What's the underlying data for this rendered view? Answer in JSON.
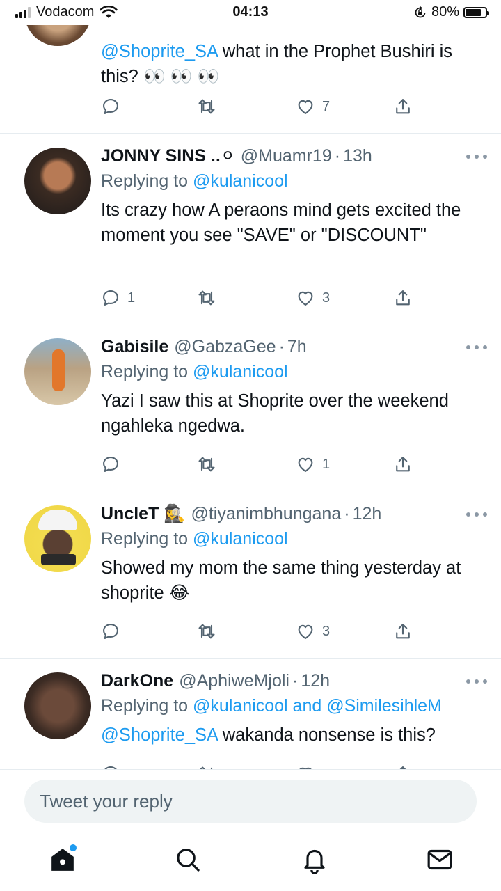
{
  "status": {
    "carrier": "Vodacom",
    "time": "04:13",
    "battery": "80%"
  },
  "tweets": [
    {
      "text_parts": [
        {
          "mention": "@Shoprite_SA"
        },
        {
          "text": " what in the Prophet Bushiri is this? 👀 👀 👀"
        }
      ],
      "reply_count": "",
      "like_count": "7"
    },
    {
      "name": "JONNY SINS ..⚪",
      "handle": "@Muamr19",
      "time": "13h",
      "replying_prefix": "Replying to ",
      "replying_to": "@kulanicool",
      "text": "Its crazy how A peraons mind gets excited the moment you see \"SAVE\" or \"DISCOUNT\"",
      "reply_count": "1",
      "like_count": "3"
    },
    {
      "name": "Gabisile",
      "handle": "@GabzaGee",
      "time": "7h",
      "replying_prefix": "Replying to ",
      "replying_to": "@kulanicool",
      "text": "Yazi I saw this at Shoprite over the weekend ngahleka ngedwa.",
      "reply_count": "",
      "like_count": "1"
    },
    {
      "name": "UncleT 🕵️‍♀️",
      "handle": "@tiyanimbhungana",
      "time": "12h",
      "replying_prefix": "Replying to ",
      "replying_to": "@kulanicool",
      "text": "Showed my mom the same thing yesterday at shoprite 😂",
      "reply_count": "",
      "like_count": "3"
    },
    {
      "name": "DarkOne",
      "handle": "@AphiweMjoli",
      "time": "12h",
      "replying_prefix": "Replying to ",
      "replying_to": "@kulanicool and @SimilesihleM",
      "text_parts": [
        {
          "mention": "@Shoprite_SA"
        },
        {
          "text": " wakanda nonsense is this?"
        }
      ]
    }
  ],
  "reply_bar": {
    "placeholder": "Tweet your reply"
  },
  "tabs": [
    "home-icon",
    "search-icon",
    "bell-icon",
    "mail-icon"
  ],
  "colors": {
    "accent": "#1d9bf0",
    "secondary_text": "#536471"
  }
}
